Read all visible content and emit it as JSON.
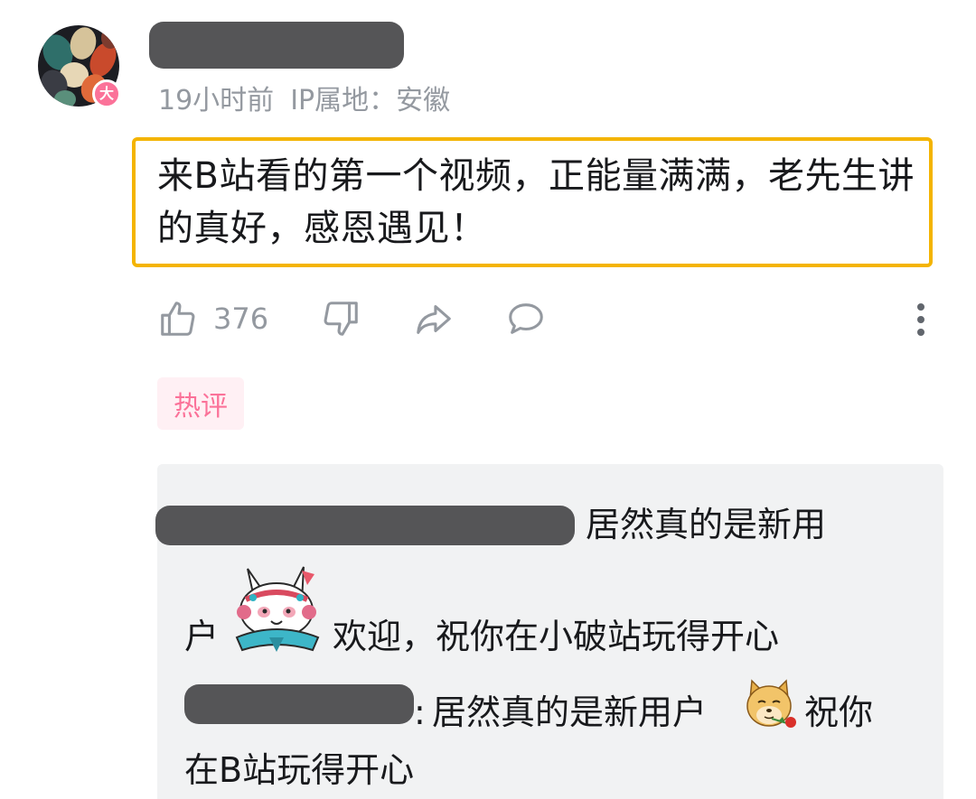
{
  "comment": {
    "avatar_badge": "大",
    "meta": {
      "time": "19小时前",
      "ip_location": "IP属地：安徽"
    },
    "text": "来B站看的第一个视频，正能量满满，老先生讲的真好，感恩遇见！",
    "actions": {
      "like_count": "376"
    },
    "tag": "热评"
  },
  "replies": [
    {
      "text_part1": "居然真的是新用",
      "text_part2": "户",
      "emoji": "rabbit-opera-emoji",
      "text_part3": "欢迎，祝你在小破站玩得开心"
    },
    {
      "colon": ":",
      "text_part1": "居然真的是新用户",
      "emoji": "doge-rose-emoji",
      "text_part2": "祝你",
      "text_part3": "在B站玩得开心"
    }
  ],
  "icons": {
    "like": "thumbs-up-icon",
    "dislike": "thumbs-down-icon",
    "share": "share-icon",
    "reply": "comment-icon",
    "more": "more-vertical-icon"
  },
  "colors": {
    "highlight_border": "#f4b400",
    "meta_gray": "#9499a0",
    "pink": "#fb7299",
    "reply_bg": "#f1f2f3",
    "redaction": "#555557"
  }
}
